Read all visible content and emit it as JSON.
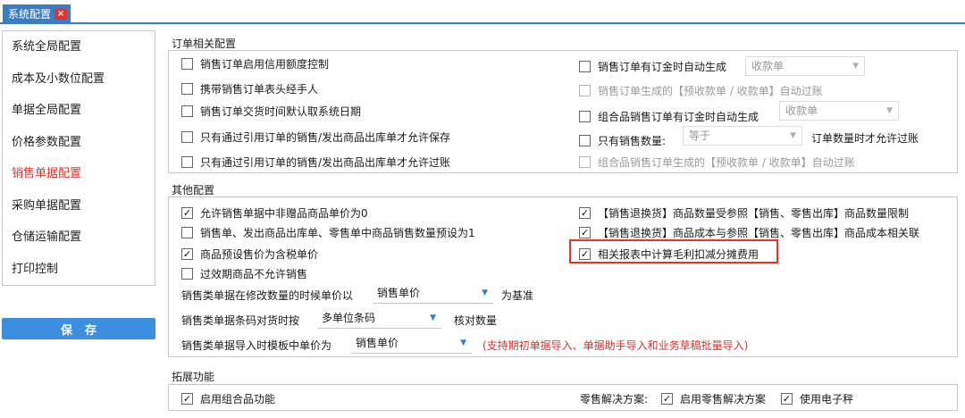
{
  "tab": {
    "title": "系统配置",
    "close": "×"
  },
  "sidebar": {
    "items": [
      {
        "label": "系统全局配置"
      },
      {
        "label": "成本及小数位配置"
      },
      {
        "label": "单据全局配置"
      },
      {
        "label": "价格参数配置"
      },
      {
        "label": "销售单据配置",
        "active": true
      },
      {
        "label": "采购单据配置"
      },
      {
        "label": "仓储运输配置"
      },
      {
        "label": "打印控制"
      }
    ],
    "save_label": "保存"
  },
  "order": {
    "title": "订单相关配置",
    "left": [
      "销售订单启用信用额度控制",
      "携带销售订单表头经手人",
      "销售订单交货时间默认取系统日期",
      "只有通过引用订单的销售/发出商品出库单才允许保存",
      "只有通过引用订单的销售/发出商品出库单才允许过账"
    ],
    "right": {
      "r1": "销售订单有订金时自动生成",
      "r1_select": "收款单",
      "r2": "销售订单生成的【预收款单 / 收款单】自动过账",
      "r3": "组合品销售订单有订金时自动生成",
      "r3_select": "收款单",
      "r4": "只有销售数量:",
      "r4_select": "等于",
      "r4_suffix": "订单数量时才允许过账",
      "r5": "组合品销售订单生成的【预收款单 / 收款单】自动过账"
    }
  },
  "other": {
    "title": "其他配置",
    "left": [
      {
        "label": "允许销售单据中非赠品商品单价为0",
        "checked": true
      },
      {
        "label": "销售单、发出商品出库单、零售单中商品销售数量预设为1",
        "checked": false
      },
      {
        "label": "商品预设售价为含税单价",
        "checked": true
      },
      {
        "label": "过效期商品不允许销售",
        "checked": false
      }
    ],
    "right": [
      {
        "label": "【销售退换货】商品数量受参照【销售、零售出库】商品数量限制",
        "checked": true
      },
      {
        "label": "【销售退换货】商品成本与参照【销售、零售出库】商品成本相关联",
        "checked": true
      },
      {
        "label": "相关报表中计算毛利扣减分摊费用",
        "checked": true
      }
    ],
    "row1": {
      "prefix": "销售类单据在修改数量的时候单价以",
      "value": "销售单价",
      "suffix": "为基准"
    },
    "row2": {
      "prefix": "销售类单据条码对货时按",
      "value": "多单位条码",
      "suffix": "核对数量"
    },
    "row3": {
      "prefix": "销售类单据导入时模板中单价为",
      "value": "销售单价",
      "note": "(支持期初单据导入、单据助手导入和业务草稿批量导入)"
    }
  },
  "ext": {
    "title": "拓展功能",
    "combo": "启用组合品功能",
    "retail_label": "零售解决方案:",
    "retail_enable": "启用零售解决方案",
    "scale": "使用电子秤"
  },
  "icons": {
    "check": "✓",
    "arrow": "▼"
  },
  "colors": {
    "accent": "#3b7dc4",
    "active": "#e0302a",
    "highlight": "#e2362c"
  }
}
